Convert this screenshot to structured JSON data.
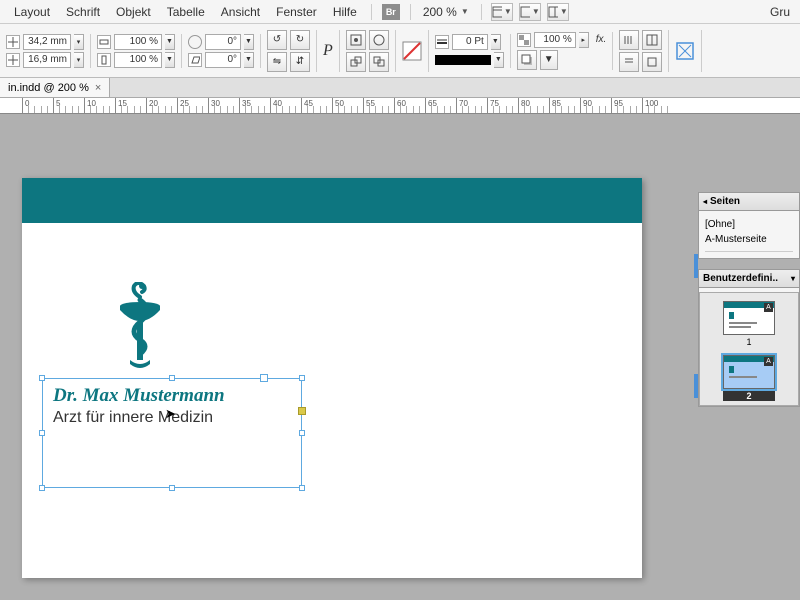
{
  "menu": {
    "items": [
      "Layout",
      "Schrift",
      "Objekt",
      "Tabelle",
      "Ansicht",
      "Fenster",
      "Hilfe"
    ],
    "bridge_label": "Br",
    "zoom_value": "200 %",
    "workspace_hint": "Gru"
  },
  "controls": {
    "x_value": "34,2 mm",
    "y_value": "16,9 mm",
    "scale_x": "100 %",
    "scale_y": "100 %",
    "rotate": "0°",
    "shear": "0°",
    "stroke": "0 Pt",
    "opacity": "100 %",
    "fx_label": "fx."
  },
  "doc_tab": {
    "name": "in.indd @ 200 %"
  },
  "ruler": {
    "marks": [
      "0",
      "5",
      "10",
      "15",
      "20",
      "25",
      "30",
      "35",
      "40",
      "45",
      "50",
      "55",
      "60",
      "65",
      "70",
      "75",
      "80",
      "85",
      "90",
      "95",
      "100"
    ]
  },
  "document": {
    "name_line": "Dr. Max Mustermann",
    "sub_line": "Arzt für innere Medizin"
  },
  "panels": {
    "seiten": {
      "title": "Seiten",
      "none": "[Ohne]",
      "master": "A-Musterseite",
      "page1_label": "1",
      "page2_label": "2",
      "master_badge": "A"
    },
    "custom": {
      "title": "Benutzerdefini.."
    }
  }
}
